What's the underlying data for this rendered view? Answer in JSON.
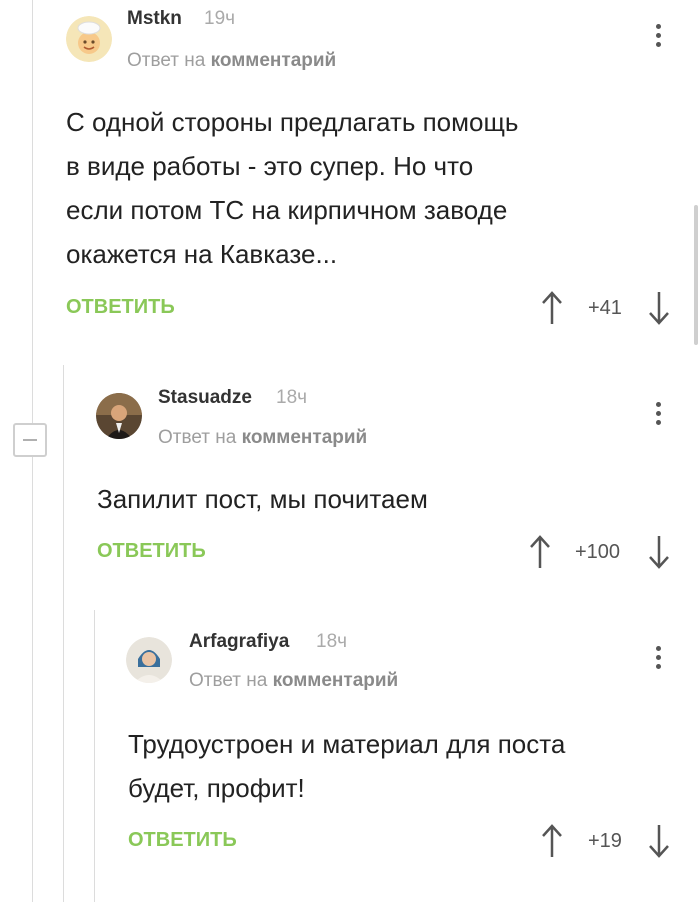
{
  "colors": {
    "reply_green": "#8ac858",
    "thread_line": "#dcdcdc",
    "muted": "#9e9e9e"
  },
  "comments": [
    {
      "username": "Mstkn",
      "time": "19ч",
      "reply_prefix": "Ответ на",
      "reply_target": "комментарий",
      "lines": [
        "С одной стороны предлагать помощь",
        "в виде работы - это супер. Но что",
        "если потом ТС на кирпичном заводе",
        "окажется на Кавказе..."
      ],
      "reply_label": "ОТВЕТИТЬ",
      "rating": "+41",
      "upvote_icon": "arrow-up-icon",
      "downvote_icon": "arrow-down-icon",
      "menu_icon": "kebab-menu-icon"
    },
    {
      "username": "Stasuadze",
      "time": "18ч",
      "reply_prefix": "Ответ на",
      "reply_target": "комментарий",
      "lines": [
        "Запилит пост, мы почитаем"
      ],
      "reply_label": "ОТВЕТИТЬ",
      "rating": "+100"
    },
    {
      "username": "Arfagrafiya",
      "time": "18ч",
      "reply_prefix": "Ответ на",
      "reply_target": "комментарий",
      "lines": [
        "Трудоустроен и материал для поста",
        "будет, профит!"
      ],
      "reply_label": "ОТВЕТИТЬ",
      "rating": "+19"
    }
  ],
  "collapse_icon": "collapse-minus-icon"
}
